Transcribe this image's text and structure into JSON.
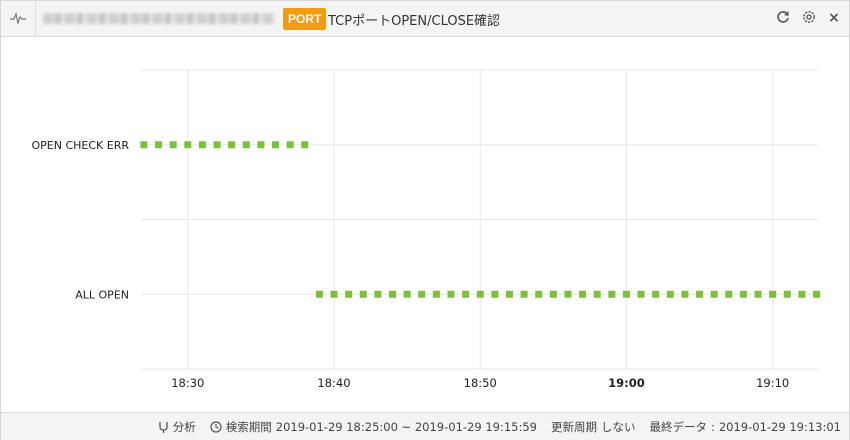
{
  "header": {
    "badge": "PORT",
    "title": "TCPポートOPEN/CLOSE確認",
    "icons": [
      "pulse-icon",
      "refresh-icon",
      "settings-icon",
      "close-icon"
    ],
    "close_glyph": "×"
  },
  "chart_data": {
    "type": "scatter",
    "categories_y": [
      "OPEN CHECK ERR",
      "ALL OPEN"
    ],
    "x_ticks": [
      "18:30",
      "18:40",
      "18:50",
      "19:00",
      "19:10"
    ],
    "x_range": [
      "18:27",
      "19:13"
    ],
    "series": [
      {
        "y": "OPEN CHECK ERR",
        "x": [
          "18:27",
          "18:28",
          "18:29",
          "18:30",
          "18:31",
          "18:32",
          "18:33",
          "18:34",
          "18:35",
          "18:36",
          "18:37",
          "18:38"
        ]
      },
      {
        "y": "ALL OPEN",
        "x": [
          "18:39",
          "18:40",
          "18:41",
          "18:42",
          "18:43",
          "18:44",
          "18:45",
          "18:46",
          "18:47",
          "18:48",
          "18:49",
          "18:50",
          "18:51",
          "18:52",
          "18:53",
          "18:54",
          "18:55",
          "18:56",
          "18:57",
          "18:58",
          "18:59",
          "19:00",
          "19:01",
          "19:02",
          "19:03",
          "19:04",
          "19:05",
          "19:06",
          "19:07",
          "19:08",
          "19:09",
          "19:10",
          "19:11",
          "19:12",
          "19:13"
        ]
      }
    ],
    "color": "#7dc03a",
    "grid": true
  },
  "footer": {
    "analysis_label": "分析",
    "period_label": "検索期間",
    "period_value": "2019-01-29 18:25:00 ~ 2019-01-29 19:15:59",
    "refresh_label": "更新周期",
    "refresh_value": "しない",
    "last_data_label": "最終データ",
    "last_data_value": "2019-01-29 19:13:01"
  }
}
